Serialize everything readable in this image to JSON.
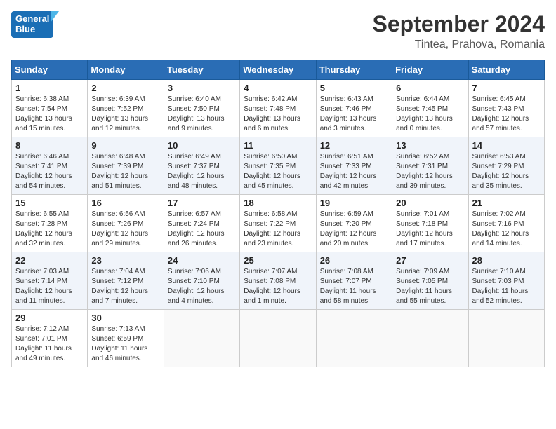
{
  "header": {
    "logo_line1": "General",
    "logo_line2": "Blue",
    "month": "September 2024",
    "location": "Tintea, Prahova, Romania"
  },
  "weekdays": [
    "Sunday",
    "Monday",
    "Tuesday",
    "Wednesday",
    "Thursday",
    "Friday",
    "Saturday"
  ],
  "weeks": [
    [
      {
        "day": "1",
        "rise": "Sunrise: 6:38 AM",
        "set": "Sunset: 7:54 PM",
        "light": "Daylight: 13 hours and 15 minutes."
      },
      {
        "day": "2",
        "rise": "Sunrise: 6:39 AM",
        "set": "Sunset: 7:52 PM",
        "light": "Daylight: 13 hours and 12 minutes."
      },
      {
        "day": "3",
        "rise": "Sunrise: 6:40 AM",
        "set": "Sunset: 7:50 PM",
        "light": "Daylight: 13 hours and 9 minutes."
      },
      {
        "day": "4",
        "rise": "Sunrise: 6:42 AM",
        "set": "Sunset: 7:48 PM",
        "light": "Daylight: 13 hours and 6 minutes."
      },
      {
        "day": "5",
        "rise": "Sunrise: 6:43 AM",
        "set": "Sunset: 7:46 PM",
        "light": "Daylight: 13 hours and 3 minutes."
      },
      {
        "day": "6",
        "rise": "Sunrise: 6:44 AM",
        "set": "Sunset: 7:45 PM",
        "light": "Daylight: 13 hours and 0 minutes."
      },
      {
        "day": "7",
        "rise": "Sunrise: 6:45 AM",
        "set": "Sunset: 7:43 PM",
        "light": "Daylight: 12 hours and 57 minutes."
      }
    ],
    [
      {
        "day": "8",
        "rise": "Sunrise: 6:46 AM",
        "set": "Sunset: 7:41 PM",
        "light": "Daylight: 12 hours and 54 minutes."
      },
      {
        "day": "9",
        "rise": "Sunrise: 6:48 AM",
        "set": "Sunset: 7:39 PM",
        "light": "Daylight: 12 hours and 51 minutes."
      },
      {
        "day": "10",
        "rise": "Sunrise: 6:49 AM",
        "set": "Sunset: 7:37 PM",
        "light": "Daylight: 12 hours and 48 minutes."
      },
      {
        "day": "11",
        "rise": "Sunrise: 6:50 AM",
        "set": "Sunset: 7:35 PM",
        "light": "Daylight: 12 hours and 45 minutes."
      },
      {
        "day": "12",
        "rise": "Sunrise: 6:51 AM",
        "set": "Sunset: 7:33 PM",
        "light": "Daylight: 12 hours and 42 minutes."
      },
      {
        "day": "13",
        "rise": "Sunrise: 6:52 AM",
        "set": "Sunset: 7:31 PM",
        "light": "Daylight: 12 hours and 39 minutes."
      },
      {
        "day": "14",
        "rise": "Sunrise: 6:53 AM",
        "set": "Sunset: 7:29 PM",
        "light": "Daylight: 12 hours and 35 minutes."
      }
    ],
    [
      {
        "day": "15",
        "rise": "Sunrise: 6:55 AM",
        "set": "Sunset: 7:28 PM",
        "light": "Daylight: 12 hours and 32 minutes."
      },
      {
        "day": "16",
        "rise": "Sunrise: 6:56 AM",
        "set": "Sunset: 7:26 PM",
        "light": "Daylight: 12 hours and 29 minutes."
      },
      {
        "day": "17",
        "rise": "Sunrise: 6:57 AM",
        "set": "Sunset: 7:24 PM",
        "light": "Daylight: 12 hours and 26 minutes."
      },
      {
        "day": "18",
        "rise": "Sunrise: 6:58 AM",
        "set": "Sunset: 7:22 PM",
        "light": "Daylight: 12 hours and 23 minutes."
      },
      {
        "day": "19",
        "rise": "Sunrise: 6:59 AM",
        "set": "Sunset: 7:20 PM",
        "light": "Daylight: 12 hours and 20 minutes."
      },
      {
        "day": "20",
        "rise": "Sunrise: 7:01 AM",
        "set": "Sunset: 7:18 PM",
        "light": "Daylight: 12 hours and 17 minutes."
      },
      {
        "day": "21",
        "rise": "Sunrise: 7:02 AM",
        "set": "Sunset: 7:16 PM",
        "light": "Daylight: 12 hours and 14 minutes."
      }
    ],
    [
      {
        "day": "22",
        "rise": "Sunrise: 7:03 AM",
        "set": "Sunset: 7:14 PM",
        "light": "Daylight: 12 hours and 11 minutes."
      },
      {
        "day": "23",
        "rise": "Sunrise: 7:04 AM",
        "set": "Sunset: 7:12 PM",
        "light": "Daylight: 12 hours and 7 minutes."
      },
      {
        "day": "24",
        "rise": "Sunrise: 7:06 AM",
        "set": "Sunset: 7:10 PM",
        "light": "Daylight: 12 hours and 4 minutes."
      },
      {
        "day": "25",
        "rise": "Sunrise: 7:07 AM",
        "set": "Sunset: 7:08 PM",
        "light": "Daylight: 12 hours and 1 minute."
      },
      {
        "day": "26",
        "rise": "Sunrise: 7:08 AM",
        "set": "Sunset: 7:07 PM",
        "light": "Daylight: 11 hours and 58 minutes."
      },
      {
        "day": "27",
        "rise": "Sunrise: 7:09 AM",
        "set": "Sunset: 7:05 PM",
        "light": "Daylight: 11 hours and 55 minutes."
      },
      {
        "day": "28",
        "rise": "Sunrise: 7:10 AM",
        "set": "Sunset: 7:03 PM",
        "light": "Daylight: 11 hours and 52 minutes."
      }
    ],
    [
      {
        "day": "29",
        "rise": "Sunrise: 7:12 AM",
        "set": "Sunset: 7:01 PM",
        "light": "Daylight: 11 hours and 49 minutes."
      },
      {
        "day": "30",
        "rise": "Sunrise: 7:13 AM",
        "set": "Sunset: 6:59 PM",
        "light": "Daylight: 11 hours and 46 minutes."
      },
      null,
      null,
      null,
      null,
      null
    ]
  ]
}
